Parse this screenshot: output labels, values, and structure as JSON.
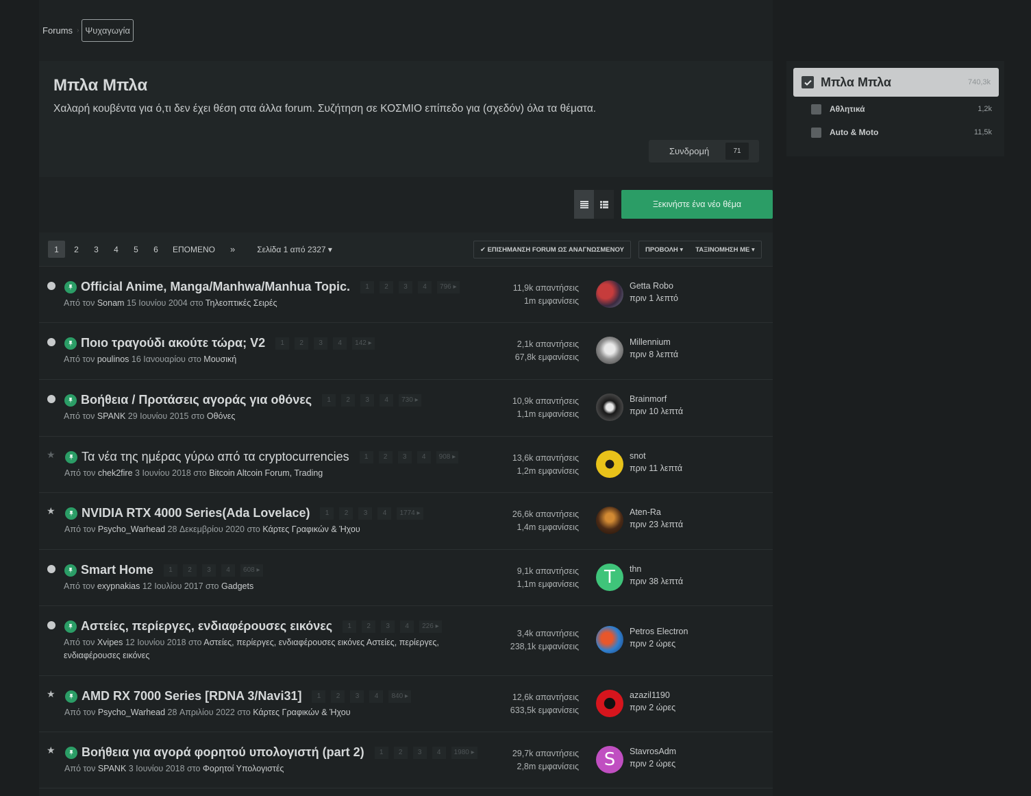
{
  "breadcrumb": {
    "root": "Forums",
    "current": "Ψυχαγωγία"
  },
  "forum": {
    "title": "Μπλα Μπλα",
    "description": "Χαλαρή κουβέντα για ό,τι δεν έχει θέση στα άλλα forum. Συζήτηση σε ΚΟΣΜΙΟ επίπεδο για (σχεδόν) όλα τα θέματα.",
    "follow_label": "Συνδρομή",
    "follow_count": "71"
  },
  "toolbar": {
    "new_topic": "Ξεκινήστε ένα νέο θέμα"
  },
  "pagination": {
    "pages": [
      "1",
      "2",
      "3",
      "4",
      "5",
      "6"
    ],
    "active": "1",
    "next": "ΕΠΟΜΕΝΟ",
    "last": "»",
    "jump": "Σελίδα 1 από 2327 ▾",
    "mark_read": "✔ ΕΠΙΣΗΜΑΝΣΗ FORUM ΩΣ ΑΝΑΓΝΩΣΜΕΝΟΥ",
    "view": "ΠΡΟΒΟΛΗ ▾",
    "sort": "ΤΑΞΙΝΟΜΗΣΗ ΜΕ ▾"
  },
  "topics": [
    {
      "title": "Official Anime, Manga/Manhwa/Manhua Topic.",
      "bold": true,
      "status": "dot",
      "pages": [
        "1",
        "2",
        "3",
        "4",
        "796 ▸"
      ],
      "by": "Από τον ",
      "author": "Sonam",
      "date": " 15 Ιουνίου 2004 στο ",
      "forum": "Τηλεοπτικές Σειρές",
      "extra": "",
      "replies": "11,9k απαντήσεις",
      "views": "1m εμφανίσεις",
      "last_user": "Getta Robo",
      "last_time": "πριν 1 λεπτό"
    },
    {
      "title": "Ποιο τραγούδι ακούτε τώρα; V2",
      "bold": true,
      "status": "dot",
      "pages": [
        "1",
        "2",
        "3",
        "4",
        "142 ▸"
      ],
      "by": "Από τον ",
      "author": "poulinos",
      "date": " 16 Ιανουαρίου στο ",
      "forum": "Μουσική",
      "extra": "",
      "replies": "2,1k απαντήσεις",
      "views": "67,8k εμφανίσεις",
      "last_user": "Millennium",
      "last_time": "πριν 8 λεπτά"
    },
    {
      "title": "Βοήθεια / Προτάσεις αγοράς για οθόνες",
      "bold": true,
      "status": "dot",
      "pages": [
        "1",
        "2",
        "3",
        "4",
        "730 ▸"
      ],
      "by": "Από τον ",
      "author": "SPANK",
      "date": " 29 Ιουνίου 2015 στο ",
      "forum": "Οθόνες",
      "extra": "",
      "replies": "10,9k απαντήσεις",
      "views": "1,1m εμφανίσεις",
      "last_user": "Brainmorf",
      "last_time": "πριν 10 λεπτά"
    },
    {
      "title": "Τα νέα της ημέρας γύρω από τα cryptocurrencies",
      "bold": false,
      "status": "star-dim",
      "pages": [
        "1",
        "2",
        "3",
        "4",
        "908 ▸"
      ],
      "by": "Από τον ",
      "author": "chek2fire",
      "date": " 3 Ιουνίου 2018 στο ",
      "forum": "Bitcoin Altcoin Forum, Trading",
      "extra": "",
      "replies": "13,6k απαντήσεις",
      "views": "1,2m εμφανίσεις",
      "last_user": "snot",
      "last_time": "πριν 11 λεπτά"
    },
    {
      "title": "NVIDIA RTX 4000 Series(Ada Lovelace)",
      "bold": true,
      "status": "star",
      "pages": [
        "1",
        "2",
        "3",
        "4",
        "1774 ▸"
      ],
      "by": "Από τον ",
      "author": "Psycho_Warhead",
      "date": " 28 Δεκεμβρίου 2020 στο ",
      "forum": "Κάρτες Γραφικών & Ήχου",
      "extra": "",
      "replies": "26,6k απαντήσεις",
      "views": "1,4m εμφανίσεις",
      "last_user": "Aten-Ra",
      "last_time": "πριν 23 λεπτά"
    },
    {
      "title": "Smart Home",
      "bold": true,
      "status": "dot",
      "pages": [
        "1",
        "2",
        "3",
        "4",
        "608 ▸"
      ],
      "by": "Από τον ",
      "author": "exypnakias",
      "date": " 12 Ιουλίου 2017 στο ",
      "forum": "Gadgets",
      "extra": "",
      "replies": "9,1k απαντήσεις",
      "views": "1,1m εμφανίσεις",
      "last_user": "thn",
      "last_time": "πριν 38 λεπτά"
    },
    {
      "title": "Αστείες, περίεργες, ενδιαφέρουσες εικόνες",
      "bold": true,
      "status": "dot",
      "pages": [
        "1",
        "2",
        "3",
        "4",
        "226 ▸"
      ],
      "by": "Από τον ",
      "author": "Xvipes",
      "date": " 12 Ιουνίου 2018 στο ",
      "forum": "Αστείες, περίεργες, ενδιαφέρουσες εικόνες Αστείες, περίεργες,",
      "extra": "ενδιαφέρουσες εικόνες",
      "replies": "3,4k απαντήσεις",
      "views": "238,1k εμφανίσεις",
      "last_user": "Petros Electron",
      "last_time": "πριν 2 ώρες"
    },
    {
      "title": "AMD RX 7000 Series [RDNA 3/Navi31]",
      "bold": true,
      "status": "star",
      "pages": [
        "1",
        "2",
        "3",
        "4",
        "840 ▸"
      ],
      "by": "Από τον ",
      "author": "Psycho_Warhead",
      "date": " 28 Απριλίου 2022 στο ",
      "forum": "Κάρτες Γραφικών & Ήχου",
      "extra": "",
      "replies": "12,6k απαντήσεις",
      "views": "633,5k εμφανίσεις",
      "last_user": "azazil1190",
      "last_time": "πριν 2 ώρες"
    },
    {
      "title": "Βοήθεια για αγορά φορητού υπολογιστή (part 2)",
      "bold": true,
      "status": "star",
      "pages": [
        "1",
        "2",
        "3",
        "4",
        "1980 ▸"
      ],
      "by": "Από τον ",
      "author": "SPANK",
      "date": " 3 Ιουνίου 2018 στο ",
      "forum": "Φορητοί Υπολογιστές",
      "extra": "",
      "replies": "29,7k απαντήσεις",
      "views": "2,8m εμφανίσεις",
      "last_user": "StavrosAdm",
      "last_time": "πριν 2 ώρες"
    }
  ],
  "sidebar": {
    "active": {
      "label": "Μπλα Μπλα",
      "count": "740,3k"
    },
    "items": [
      {
        "label": "Αθλητικά",
        "count": "1,2k"
      },
      {
        "label": "Auto & Moto",
        "count": "11,5k"
      }
    ]
  },
  "colors": {
    "accent": "#2b9d66",
    "background": "#1b1e1f"
  }
}
